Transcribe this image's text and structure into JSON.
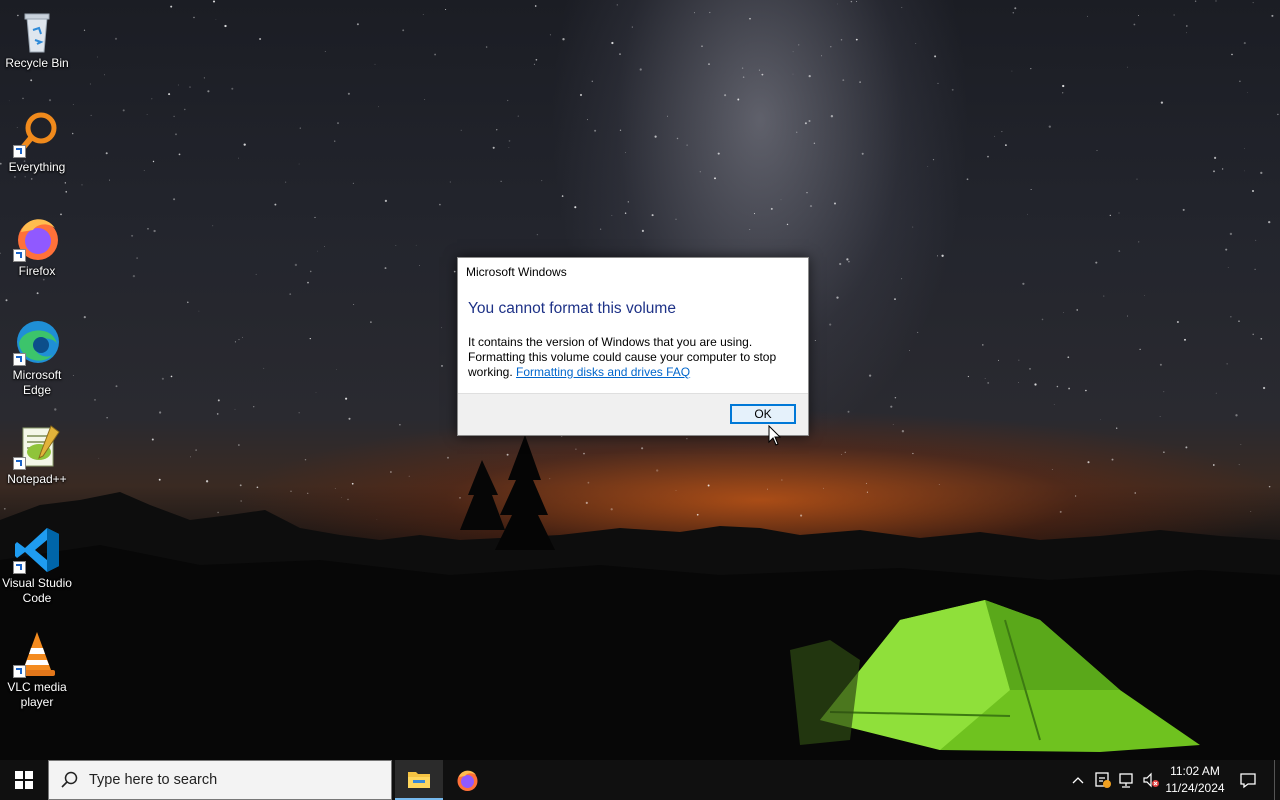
{
  "desktop": {
    "icons": [
      {
        "label": "Recycle Bin",
        "icon": "recycle-bin-icon"
      },
      {
        "label": "Everything",
        "icon": "everything-search-icon"
      },
      {
        "label": "Firefox",
        "icon": "firefox-icon"
      },
      {
        "label": "Microsoft Edge",
        "icon": "edge-icon"
      },
      {
        "label": "Notepad++",
        "icon": "notepad-plus-plus-icon"
      },
      {
        "label": "Visual Studio Code",
        "icon": "vscode-icon"
      },
      {
        "label": "VLC media player",
        "icon": "vlc-icon"
      }
    ]
  },
  "dialog": {
    "title": "Microsoft Windows",
    "heading": "You cannot format this volume",
    "body": "It contains the version of Windows that you are using. Formatting this volume could cause your computer to stop working.",
    "link": "Formatting disks and drives FAQ",
    "ok_label": "OK"
  },
  "taskbar": {
    "search_placeholder": "Type here to search",
    "apps": [
      {
        "name": "File Explorer",
        "icon": "file-explorer-icon",
        "active": true
      },
      {
        "name": "Firefox",
        "icon": "firefox-icon",
        "active": false
      }
    ],
    "tray_icons": [
      "chevron-up-icon",
      "security-warning-icon",
      "network-icon",
      "volume-muted-icon"
    ],
    "time": "11:02 AM",
    "date": "11/24/2024",
    "notification_icon": "action-center-icon"
  },
  "colors": {
    "accent": "#0078d7",
    "dialog_heading": "#1e3287",
    "link": "#0066cc",
    "taskbar": "#101010"
  }
}
